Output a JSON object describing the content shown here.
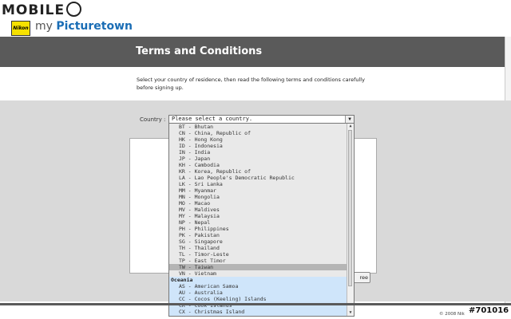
{
  "watermark": {
    "text": "MOBILE"
  },
  "header": {
    "nikon_label": "Nikon",
    "brand_prefix": "my ",
    "brand_name": "Picturetown"
  },
  "page": {
    "title": "Terms and Conditions",
    "instruction": "Select your country of residence, then read the following terms and conditions carefully before signing up."
  },
  "country": {
    "label": "Country :",
    "selected": "Please select a country.",
    "options": [
      "BT - Bhutan",
      "CN - China, Republic of",
      "HK - Hong Kong",
      "ID - Indonesia",
      "IN - India",
      "JP - Japan",
      "KH - Cambodia",
      "KR - Korea, Republic of",
      "LA - Lao People's Democratic Republic",
      "LK - Sri Lanka",
      "MM - Myanmar",
      "MN - Mongolia",
      "MO - Macao",
      "MV - Maldives",
      "MY - Malaysia",
      "NP - Nepal",
      "PH - Philippines",
      "PK - Pakistan",
      "SG - Singapore",
      "TH - Thailand",
      "TL - Timor-Leste",
      "TP - East Timor",
      "TW - Taiwan",
      "VN - Vietnam"
    ],
    "group_label": "Oceania",
    "group_options": [
      "AS - American Samoa",
      "AU - Australia",
      "CC - Cocos (Keeling) Islands",
      "CK - Cook Islands",
      "CX - Christmas Island"
    ]
  },
  "agree_button": "ree",
  "footer": {
    "copyright": "© 2008 Nik",
    "stamp": "#701016"
  },
  "colors": {
    "titlebar": "#5a5a5a",
    "panel": "#d9d9d9",
    "highlight": "#b5b5b5",
    "group_highlight": "#cfe5fa",
    "brand": "#1a6db5"
  }
}
